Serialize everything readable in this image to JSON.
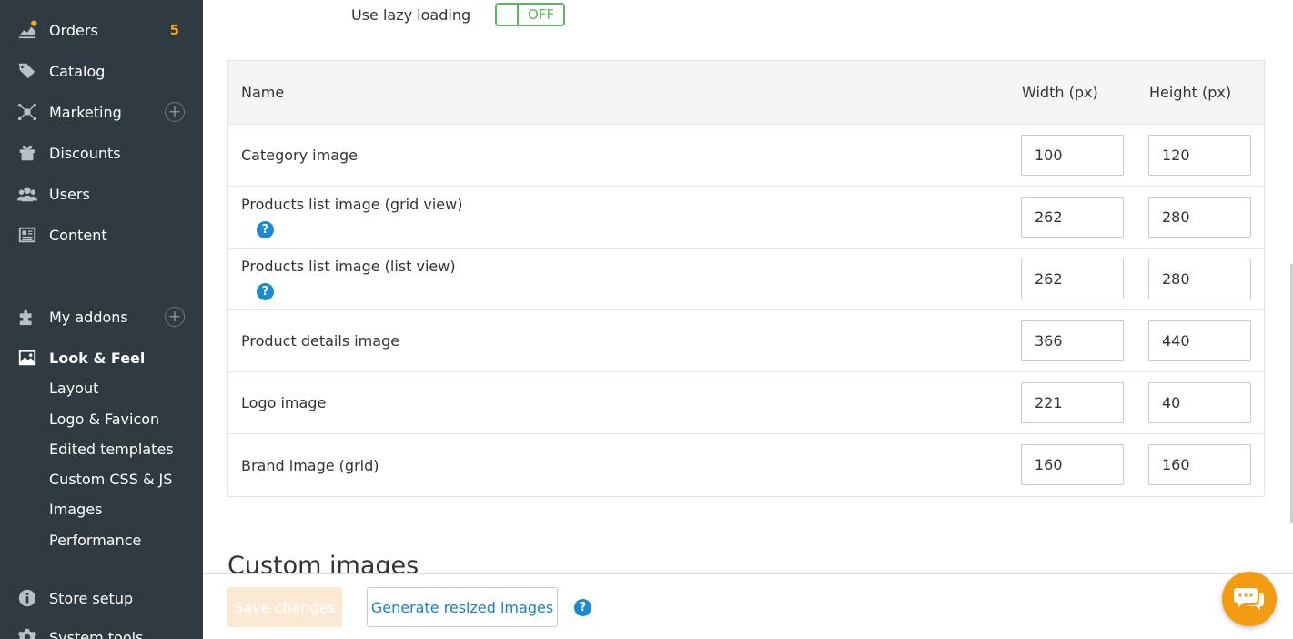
{
  "sidebar": {
    "items": [
      {
        "label": "Orders",
        "badge": "5",
        "icon": "orders-icon"
      },
      {
        "label": "Catalog",
        "icon": "tag-icon"
      },
      {
        "label": "Marketing",
        "icon": "marketing-icon"
      },
      {
        "label": "Discounts",
        "icon": "gift-icon"
      },
      {
        "label": "Users",
        "icon": "users-icon"
      },
      {
        "label": "Content",
        "icon": "newspaper-icon"
      },
      {
        "label": "My addons",
        "icon": "puzzle-icon"
      },
      {
        "label": "Look & Feel",
        "icon": "image-icon"
      },
      {
        "label": "Store setup",
        "icon": "info-icon"
      },
      {
        "label": "System tools",
        "icon": "gear-icon"
      }
    ],
    "look_feel_sub": [
      "Layout",
      "Logo & Favicon",
      "Edited templates",
      "Custom CSS & JS",
      "Images",
      "Performance"
    ]
  },
  "lazy_loading": {
    "label": "Use lazy loading",
    "state": "OFF"
  },
  "table": {
    "headers": {
      "name": "Name",
      "width": "Width (px)",
      "height": "Height (px)"
    },
    "rows": [
      {
        "name": "Category image",
        "width": "100",
        "height": "120"
      },
      {
        "name": "Products list image (grid view)",
        "width": "262",
        "height": "280"
      },
      {
        "name": "Products list image (list view)",
        "width": "262",
        "height": "280"
      },
      {
        "name": "Product details image",
        "width": "366",
        "height": "440"
      },
      {
        "name": "Logo image",
        "width": "221",
        "height": "40"
      },
      {
        "name": "Brand image (grid)",
        "width": "160",
        "height": "160"
      }
    ]
  },
  "custom_images": {
    "heading": "Custom images"
  },
  "footer": {
    "save_label": "Save changes",
    "generate_label": "Generate resized images"
  },
  "colors": {
    "sidebar_bg": "#2f3a41",
    "accent_orange": "#f39c12",
    "link_blue": "#1b7fc4",
    "toggle_green": "#5cb85c"
  }
}
